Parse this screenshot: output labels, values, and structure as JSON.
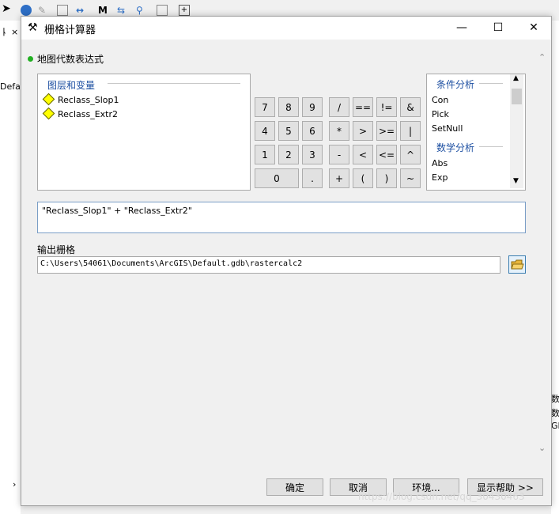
{
  "dialog": {
    "title": "栅格计算器",
    "close": "✕",
    "maximize": "☐",
    "minimize": "—"
  },
  "map_algebra": {
    "label": "地图代数表达式"
  },
  "layers": {
    "title": "图层和变量",
    "items": [
      "Reclass_Slop1",
      "Reclass_Extr2"
    ]
  },
  "keypad": {
    "row1": [
      "7",
      "8",
      "9",
      "/",
      "==",
      "!=",
      "&"
    ],
    "row2": [
      "4",
      "5",
      "6",
      "*",
      ">",
      ">=",
      "|"
    ],
    "row3": [
      "1",
      "2",
      "3",
      "-",
      "<",
      "<=",
      "^"
    ],
    "row4": [
      "0",
      ".",
      "+",
      "(",
      ")",
      "~"
    ]
  },
  "functions": {
    "group1": {
      "title": "条件分析",
      "items": [
        "Con",
        "Pick",
        "SetNull"
      ]
    },
    "group2": {
      "title": "数学分析",
      "items": [
        "Abs",
        "Exp"
      ]
    }
  },
  "expression": "\"Reclass_Slop1\" + \"Reclass_Extr2\"",
  "output": {
    "label": "输出栅格",
    "path": "C:\\Users\\54061\\Documents\\ArcGIS\\Default.gdb\\rastercalc2"
  },
  "buttons": {
    "ok": "确定",
    "cancel": "取消",
    "env": "环境...",
    "help": "显示帮助 >>"
  },
  "background": {
    "left_text": "Defa",
    "right_texts": [
      "数",
      "数",
      "GI"
    ]
  },
  "watermark": "https://blog.csdn.net/qq_30430463"
}
